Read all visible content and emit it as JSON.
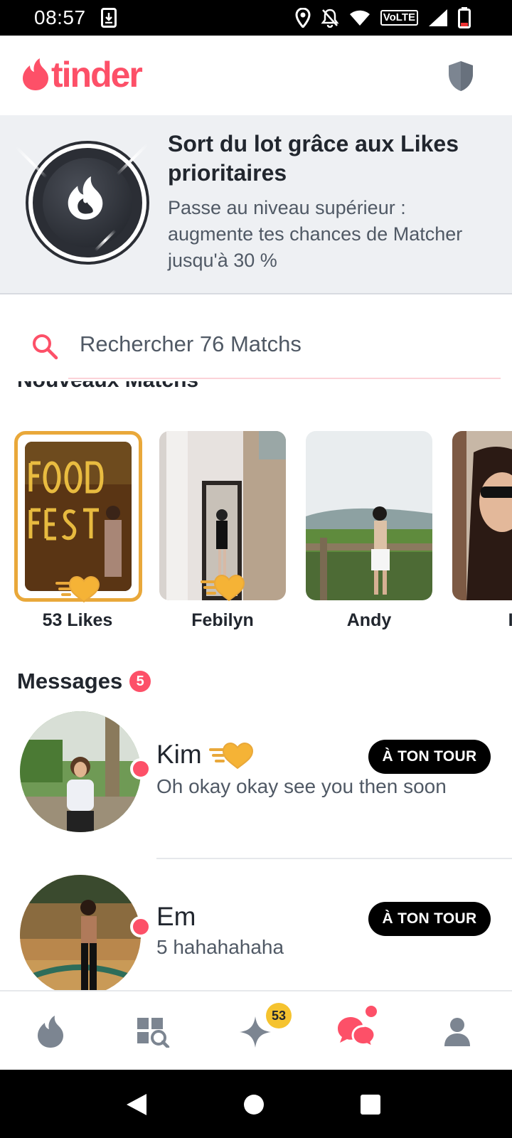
{
  "status_bar": {
    "time": "08:57",
    "network": "VoLTE"
  },
  "header": {
    "logo_text": "tinder",
    "shield_icon": "shield-icon"
  },
  "promo": {
    "title": "Sort du lot grâce aux Likes prioritaires",
    "text": "Passe au niveau supérieur : augmente tes chances de Matcher jusqu'à 30 %"
  },
  "search": {
    "placeholder": "Rechercher 76 Matchs"
  },
  "new_matches": {
    "title": "Nouveaux Matchs",
    "items": [
      {
        "name": "53 Likes"
      },
      {
        "name": "Febilyn"
      },
      {
        "name": "Andy"
      },
      {
        "name": "Ia"
      }
    ]
  },
  "messages": {
    "title": "Messages",
    "count": "5",
    "rows": [
      {
        "name": "Kim",
        "preview": "Oh okay okay see you then soon",
        "tag": "À TON TOUR"
      },
      {
        "name": "Em",
        "preview": "5 hahahahaha",
        "tag": "À TON TOUR"
      }
    ]
  },
  "tabbar": {
    "likes_count": "53"
  },
  "colors": {
    "brand": "#fd5068",
    "gold": "#e9a83a",
    "text": "#21262e",
    "muted": "#505965"
  }
}
